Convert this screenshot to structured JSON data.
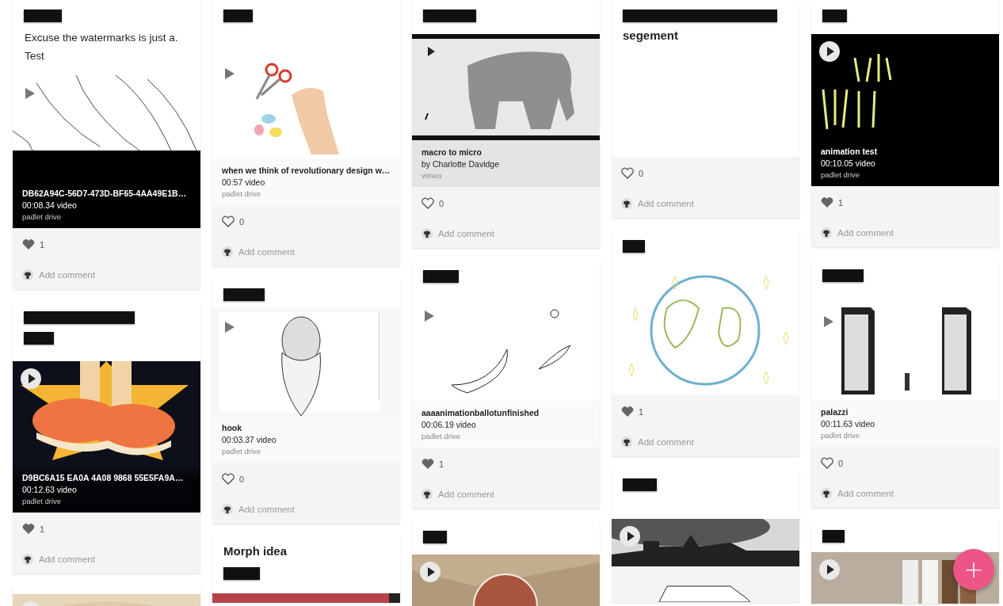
{
  "columns": [
    {
      "cards": [
        {
          "header": [
            {
              "kind": "redaction"
            },
            {
              "kind": "body",
              "text": "Excuse the watermarks is just a."
            },
            {
              "kind": "body",
              "text": "Test"
            }
          ],
          "media": {
            "kind": "flatplay",
            "caption": {
              "kind": "overlay",
              "title": "DB62A94C-56D7-473D-BF65-4AA49E1B…",
              "meta": "00:08.34 video",
              "source": "padlet drive"
            }
          },
          "footer": {
            "liked": true,
            "likes": "1",
            "comment": "Add comment"
          }
        },
        {
          "header": [
            {
              "kind": "redaction"
            },
            {
              "kind": "redaction"
            }
          ],
          "media": {
            "kind": "roundplay",
            "caption": {
              "kind": "overlay",
              "title": "D9BC6A15 EA0A 4A08 9868 55E5FA9A…",
              "meta": "00:12.63 video",
              "source": "padlet drive"
            }
          },
          "footer": {
            "liked": true,
            "likes": "1",
            "comment": "Add comment"
          }
        },
        {
          "media": {
            "kind": "roundplay"
          }
        }
      ]
    },
    {
      "cards": [
        {
          "header": [
            {
              "kind": "redaction"
            }
          ],
          "media": {
            "kind": "flatplay",
            "caption": {
              "kind": "plain",
              "title": "when we think of revolutionary design w…",
              "meta": "00:57 video",
              "source": "padlet drive"
            }
          },
          "footer": {
            "liked": false,
            "likes": "0",
            "comment": "Add comment"
          }
        },
        {
          "header": [
            {
              "kind": "redaction"
            }
          ],
          "media": {
            "kind": "flatplay",
            "caption": {
              "kind": "plain",
              "title": "hook",
              "meta": "00:03.37 video",
              "source": "padlet drive"
            }
          },
          "footer": {
            "liked": false,
            "likes": "0",
            "comment": "Add comment"
          }
        },
        {
          "header": [
            {
              "kind": "heading",
              "text": "Morph idea"
            },
            {
              "kind": "redaction"
            }
          ],
          "media": {
            "kind": "picture"
          }
        }
      ]
    },
    {
      "cards": [
        {
          "header": [
            {
              "kind": "redaction"
            }
          ],
          "media": {
            "kind": "roundplay",
            "caption": {
              "kind": "shaded",
              "title": "macro to micro",
              "meta": "by Charlotte Davidge",
              "source": "vimeo"
            }
          },
          "footer": {
            "liked": false,
            "likes": "0",
            "comment": "Add comment"
          }
        },
        {
          "header": [
            {
              "kind": "redaction"
            }
          ],
          "media": {
            "kind": "flatplay",
            "caption": {
              "kind": "plain",
              "title": "aaaanimationballotunfinished",
              "meta": "00:06.19 video",
              "source": "padlet drive"
            }
          },
          "footer": {
            "liked": true,
            "likes": "1",
            "comment": "Add comment"
          }
        },
        {
          "header": [
            {
              "kind": "redaction"
            }
          ],
          "media": {
            "kind": "roundplay"
          }
        }
      ]
    },
    {
      "cards": [
        {
          "header": [
            {
              "kind": "redaction"
            },
            {
              "kind": "heading",
              "text": "segement"
            }
          ],
          "footer": {
            "liked": false,
            "likes": "0",
            "comment": "Add comment"
          }
        },
        {
          "header": [
            {
              "kind": "redaction"
            }
          ],
          "media": {
            "kind": "picture"
          },
          "footer": {
            "liked": true,
            "likes": "1",
            "comment": "Add comment"
          }
        },
        {
          "header": [
            {
              "kind": "redaction"
            }
          ],
          "media": {
            "kind": "roundplay"
          }
        }
      ]
    },
    {
      "cards": [
        {
          "header": [
            {
              "kind": "redaction"
            }
          ],
          "media": {
            "kind": "roundplay",
            "caption": {
              "kind": "overlay",
              "title": "animation test",
              "meta": "00:10.05 video",
              "source": "padlet drive"
            }
          },
          "footer": {
            "liked": true,
            "likes": "1",
            "comment": "Add comment"
          }
        },
        {
          "header": [
            {
              "kind": "redaction"
            }
          ],
          "media": {
            "kind": "flatplay",
            "caption": {
              "kind": "plain",
              "title": "palazzi",
              "meta": "00:11.63 video",
              "source": "padlet drive"
            }
          },
          "footer": {
            "liked": false,
            "likes": "0",
            "comment": "Add comment"
          }
        },
        {
          "header": [
            {
              "kind": "redaction"
            }
          ],
          "media": {
            "kind": "roundplay"
          }
        }
      ]
    }
  ],
  "fab": {
    "label": "+"
  }
}
